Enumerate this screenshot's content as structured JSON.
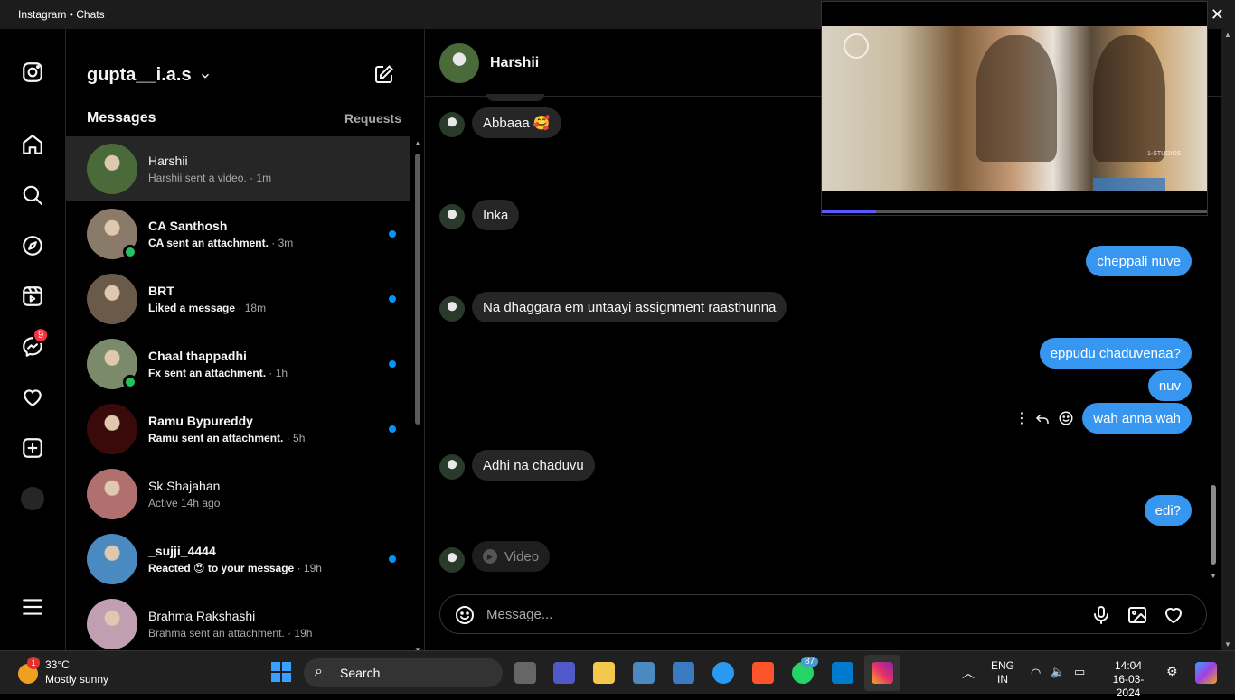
{
  "window": {
    "title": "Instagram • Chats"
  },
  "rail": {
    "badge": "9"
  },
  "sidebar": {
    "account": "gupta__i.a.s",
    "messages_label": "Messages",
    "requests_label": "Requests",
    "chats": [
      {
        "name": "Harshii",
        "subtitle": "Harshii sent a video.",
        "time": "· 1m",
        "unread": false,
        "active": true,
        "online": false,
        "avatar_color": "#4a6a3a"
      },
      {
        "name": "CA Santhosh",
        "subtitle": "CA sent an attachment.",
        "time": "· 3m",
        "unread": true,
        "active": false,
        "online": true,
        "avatar_color": "#8a7a6a"
      },
      {
        "name": "BRT",
        "subtitle": "Liked a message",
        "time": "· 18m",
        "unread": true,
        "active": false,
        "online": false,
        "avatar_color": "#6a5a4a"
      },
      {
        "name": "Chaal thappadhi",
        "subtitle": "Fx sent an attachment.",
        "time": "· 1h",
        "unread": true,
        "active": false,
        "online": true,
        "avatar_color": "#7a8a6a"
      },
      {
        "name": "Ramu Bypureddy",
        "subtitle": "Ramu sent an attachment.",
        "time": "· 5h",
        "unread": true,
        "active": false,
        "online": false,
        "avatar_color": "#3a0a0a"
      },
      {
        "name": "Sk.Shajahan",
        "subtitle": "Active 14h ago",
        "time": "",
        "unread": false,
        "active": false,
        "online": false,
        "avatar_color": "#b07070"
      },
      {
        "name": "_sujji_4444",
        "subtitle": "Reacted 😍 to your message",
        "time": "· 19h",
        "unread": true,
        "active": false,
        "online": false,
        "avatar_color": "#4a8ac0"
      },
      {
        "name": "Brahma Rakshashi",
        "subtitle": "Brahma sent an attachment.",
        "time": "· 19h",
        "unread": false,
        "active": false,
        "online": false,
        "avatar_color": "#c0a0b0"
      }
    ]
  },
  "chat": {
    "contact_name": "Harshii",
    "messages": [
      {
        "text": "Abbaaa 🥰",
        "dir": "in"
      },
      {
        "text": "Inka",
        "dir": "in"
      },
      {
        "text": "cheppali nuve",
        "dir": "out"
      },
      {
        "text": "Na dhaggara em untaayi assignment raasthunna",
        "dir": "in"
      },
      {
        "text": "eppudu chaduvenaa?",
        "dir": "out"
      },
      {
        "text": "nuv",
        "dir": "out"
      },
      {
        "text": "wah anna wah",
        "dir": "out"
      },
      {
        "text": "Adhi na chaduvu",
        "dir": "in"
      },
      {
        "text": "edi?",
        "dir": "out"
      },
      {
        "text": "Video",
        "dir": "in"
      }
    ],
    "composer_placeholder": "Message..."
  },
  "video_pip": {
    "progress": 0.14,
    "watermark": "1-STUDIOS"
  },
  "taskbar": {
    "weather_badge": "1",
    "temperature": "33°C",
    "weather_desc": "Mostly sunny",
    "search_label": "Search",
    "whatsapp_badge": "87",
    "lang_line1": "ENG",
    "lang_line2": "IN",
    "time": "14:04",
    "date": "16-03-2024"
  }
}
